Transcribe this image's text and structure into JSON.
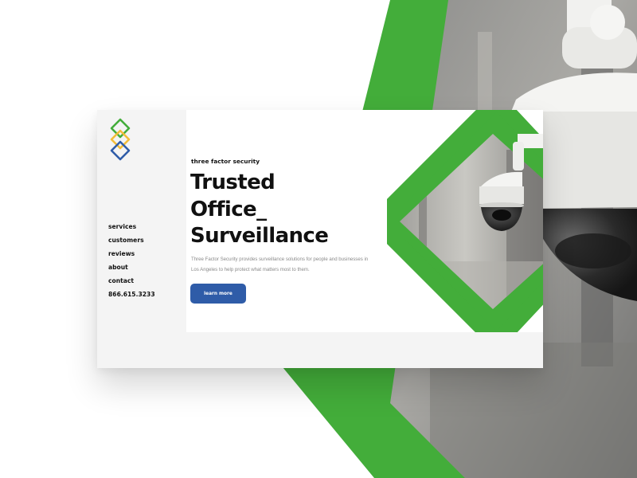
{
  "brand": {
    "tagline": "three factor security",
    "logo_icon": "three-linked-diamonds-icon",
    "colors": {
      "green": "#43ad3a",
      "yellow": "#f3bd3a",
      "blue": "#2f5ca8",
      "text": "#111111"
    }
  },
  "nav": {
    "items": [
      {
        "label": "services"
      },
      {
        "label": "customers"
      },
      {
        "label": "reviews"
      },
      {
        "label": "about"
      },
      {
        "label": "contact"
      },
      {
        "label": "866.615.3233"
      }
    ]
  },
  "hero": {
    "headline_lines": [
      "Trusted",
      "Office_",
      "Surveillance"
    ],
    "description": "Three Factor Security provides surveillance solutions for people and businesses in Los Angeles to help protect what matters most to them.",
    "cta_label": "learn more",
    "image_icon": "security-camera-photo-icon"
  }
}
